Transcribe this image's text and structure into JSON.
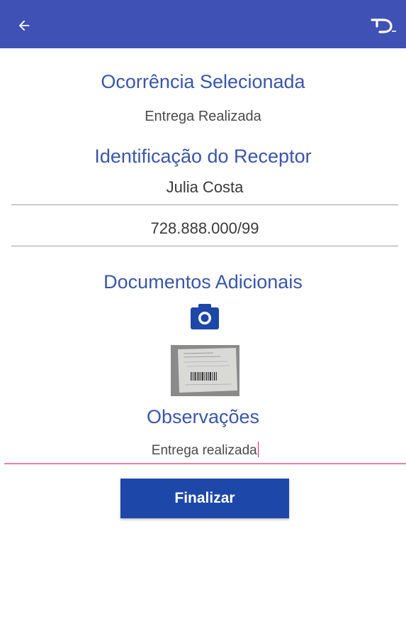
{
  "colors": {
    "appbar": "#3f51b5",
    "title": "#3a56a8",
    "button": "#1d47a8",
    "focus_line": "#ef7fa4"
  },
  "appbar": {
    "back_icon": "arrow-left-icon",
    "logo_icon": "app-logo-icon"
  },
  "ocorrencia": {
    "title": "Ocorrência Selecionada",
    "value": "Entrega Realizada"
  },
  "receptor": {
    "title": "Identificação do Receptor",
    "name_value": "Julia Costa",
    "document_value": "728.888.000/99"
  },
  "documentos": {
    "title": "Documentos Adicionais",
    "camera_icon": "camera-icon"
  },
  "observacoes": {
    "title": "Observações",
    "value": "Entrega realizada"
  },
  "actions": {
    "finalizar_label": "Finalizar"
  }
}
